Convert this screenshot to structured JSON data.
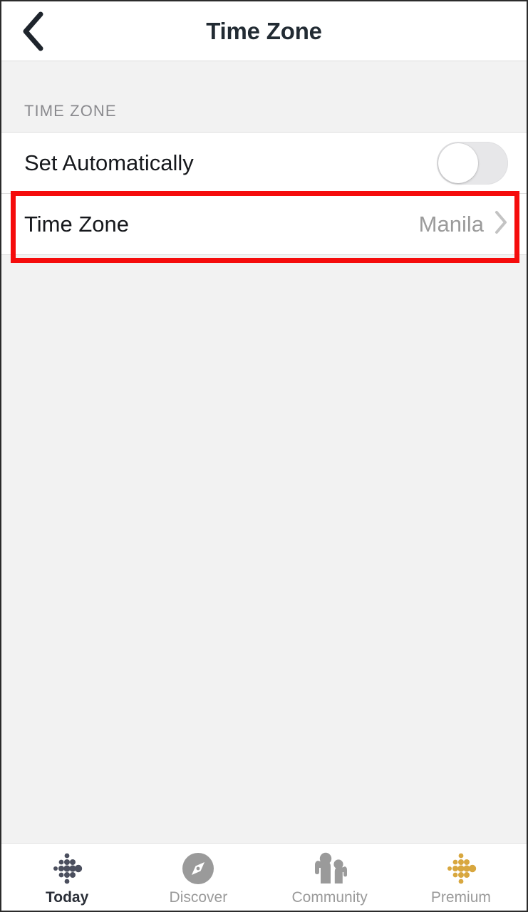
{
  "navbar": {
    "title": "Time Zone",
    "back_icon": "chevron-left-icon"
  },
  "section": {
    "header": "TIME ZONE"
  },
  "rows": [
    {
      "name": "set-automatically",
      "label": "Set Automatically",
      "control": "toggle",
      "toggle_state": "off"
    },
    {
      "name": "time-zone",
      "label": "Time Zone",
      "value": "Manila",
      "control": "chevron",
      "highlighted": true
    }
  ],
  "highlight": {
    "color": "#f50c0c"
  },
  "tabbar": {
    "tabs": [
      {
        "label": "Today",
        "icon": "fitbit-dots-icon",
        "active": true
      },
      {
        "label": "Discover",
        "icon": "compass-icon",
        "active": false
      },
      {
        "label": "Community",
        "icon": "people-icon",
        "active": false
      },
      {
        "label": "Premium",
        "icon": "fitbit-dots-gold-icon",
        "active": false
      }
    ]
  },
  "colors": {
    "title": "#222b33",
    "section_header": "#8a8a8e",
    "row_label": "#16181c",
    "row_value": "#9b9b9b",
    "background": "#f2f2f2",
    "card": "#ffffff",
    "tab_active": "#2b2f38",
    "tab_inactive": "#9a9a9a",
    "premium_gold": "#d6a councils"
  }
}
